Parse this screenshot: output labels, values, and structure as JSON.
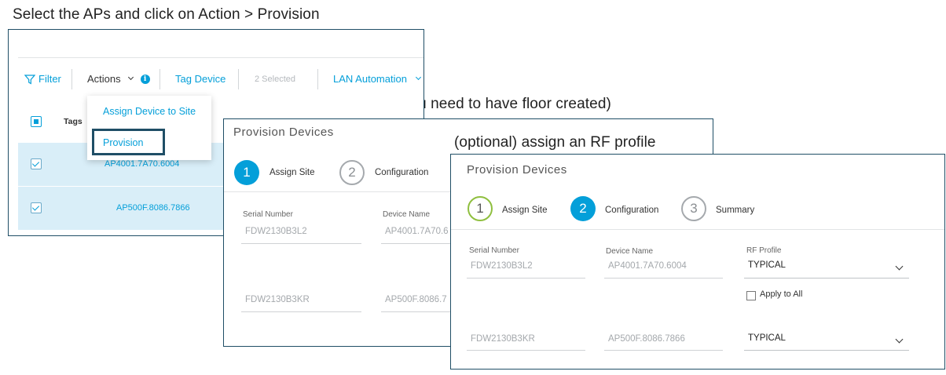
{
  "captions": {
    "step1": "Select the APs and click on Action > Provision",
    "step2": "Assign them to the floor (you need to have floor created)",
    "step3": "(optional) assign an RF profile"
  },
  "inventory": {
    "toolbar": {
      "filter": "Filter",
      "actions": "Actions",
      "tag_device": "Tag Device",
      "selected": "2 Selected",
      "lan_automation": "LAN Automation"
    },
    "header_tags": "Tags",
    "menu": {
      "assign_device_to_site": "Assign Device to Site",
      "provision": "Provision"
    },
    "rows": [
      {
        "name": "AP4001.7A70.6004"
      },
      {
        "name": "AP500F.8086.7866"
      }
    ]
  },
  "provision_assign": {
    "title": "Provision Devices",
    "steps": [
      {
        "num": "1",
        "label": "Assign Site"
      },
      {
        "num": "2",
        "label": "Configuration"
      }
    ],
    "columns": {
      "serial": "Serial Number",
      "device_name": "Device Name"
    },
    "devices": [
      {
        "serial": "FDW2130B3L2",
        "device_name": "AP4001.7A70.6"
      },
      {
        "serial": "FDW2130B3KR",
        "device_name": "AP500F.8086.7"
      }
    ]
  },
  "provision_config": {
    "title": "Provision Devices",
    "steps": [
      {
        "num": "1",
        "label": "Assign Site"
      },
      {
        "num": "2",
        "label": "Configuration"
      },
      {
        "num": "3",
        "label": "Summary"
      }
    ],
    "columns": {
      "serial": "Serial Number",
      "device_name": "Device Name",
      "rf_profile": "RF Profile"
    },
    "devices": [
      {
        "serial": "FDW2130B3L2",
        "device_name": "AP4001.7A70.6004",
        "rf_profile": "TYPICAL"
      },
      {
        "serial": "FDW2130B3KR",
        "device_name": "AP500F.8086.7866",
        "rf_profile": "TYPICAL"
      }
    ],
    "apply_to_all": "Apply to All"
  },
  "colors": {
    "accent": "#049fd9",
    "frame": "#1f4e66",
    "selected_row": "#d9eef8",
    "done_step": "#8fbf3f"
  }
}
